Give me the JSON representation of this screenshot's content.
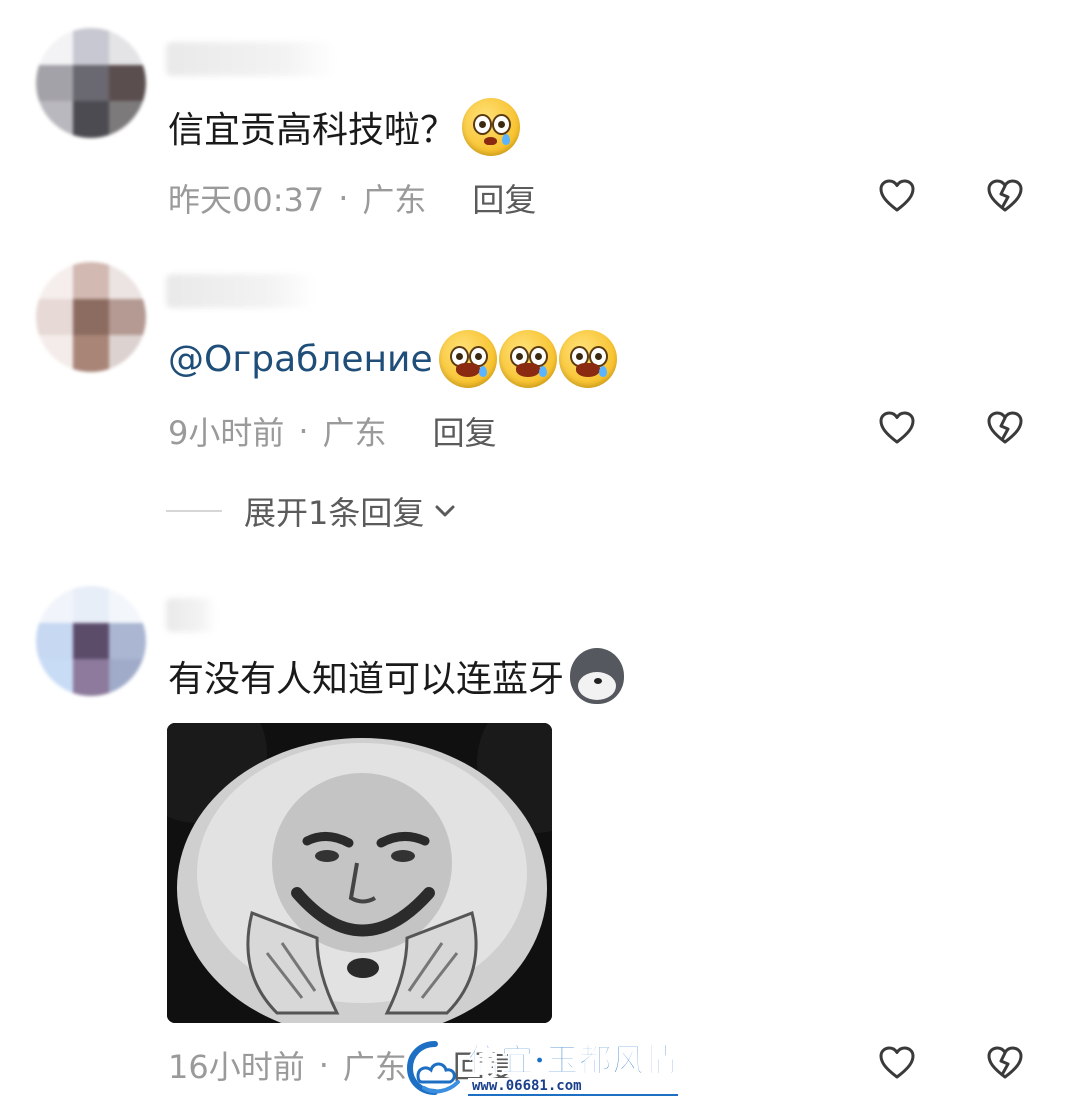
{
  "comments": [
    {
      "text": "信宜贡高科技啦？",
      "emoji": [
        "emoji-tearful-icon"
      ],
      "time": "昨天00:37",
      "separator": "·",
      "location": "广东",
      "reply_label": "回复"
    },
    {
      "mention": "@Ограбление",
      "emoji": [
        "emoji-crying-icon",
        "emoji-crying-icon",
        "emoji-crying-icon"
      ],
      "time": "9小时前",
      "separator": "·",
      "location": "广东",
      "reply_label": "回复",
      "expand_label": "展开1条回复"
    },
    {
      "text": "有没有人知道可以连蓝牙",
      "emoji": [
        "emoji-husky-icon"
      ],
      "image": "meme-panda-face-image",
      "time": "16小时前",
      "separator": "·",
      "location": "广东",
      "reply_label": "回复"
    }
  ],
  "watermark": {
    "title": "信宜·玉都风情",
    "url": "www.06681.com"
  },
  "colors": {
    "mention": "#1f4e79",
    "meta": "#9a9a9a",
    "reply": "#5b5b5b"
  }
}
